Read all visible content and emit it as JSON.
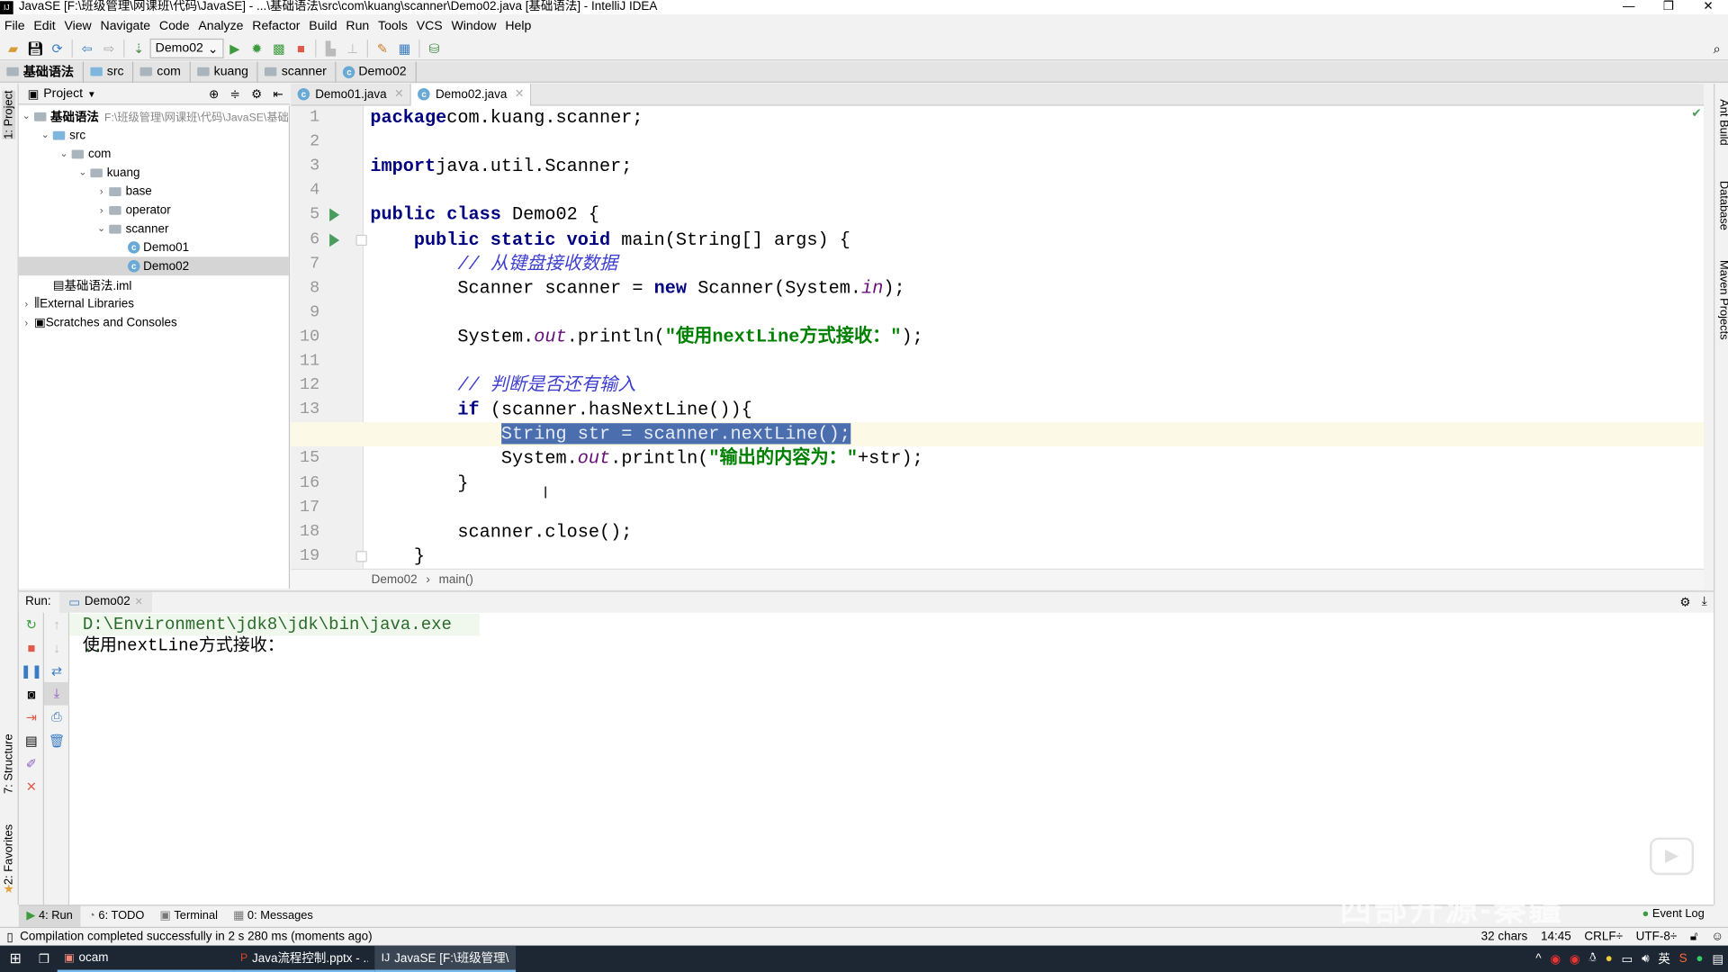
{
  "window": {
    "title": "JavaSE [F:\\班级管理\\网课班\\代码\\JavaSE] - ...\\基础语法\\src\\com\\kuang\\scanner\\Demo02.java [基础语法] - IntelliJ IDEA",
    "logo": "IJ"
  },
  "menu": [
    "File",
    "Edit",
    "View",
    "Navigate",
    "Code",
    "Analyze",
    "Refactor",
    "Build",
    "Run",
    "Tools",
    "VCS",
    "Window",
    "Help"
  ],
  "toolbar": {
    "run_config": "Demo02"
  },
  "breadcrumbs": [
    "基础语法",
    "src",
    "com",
    "kuang",
    "scanner",
    "Demo02"
  ],
  "left_strip": {
    "project": "1: Project",
    "structure": "7: Structure",
    "favorites": "2: Favorites"
  },
  "right_strip": [
    "Ant Build",
    "Database",
    "Maven Projects"
  ],
  "project": {
    "header": "Project",
    "root": {
      "name": "基础语法",
      "path": "F:\\班级管理\\网课班\\代码\\JavaSE\\基础"
    },
    "nodes": [
      {
        "label": "src",
        "type": "src-folder",
        "arrow": "v",
        "depth": 1
      },
      {
        "label": "com",
        "type": "folder",
        "arrow": "v",
        "depth": 2
      },
      {
        "label": "kuang",
        "type": "folder",
        "arrow": "v",
        "depth": 3
      },
      {
        "label": "base",
        "type": "folder",
        "arrow": ">",
        "depth": 4
      },
      {
        "label": "operator",
        "type": "folder",
        "arrow": ">",
        "depth": 4
      },
      {
        "label": "scanner",
        "type": "folder",
        "arrow": "v",
        "depth": 4
      },
      {
        "label": "Demo01",
        "type": "class",
        "arrow": "",
        "depth": 5
      },
      {
        "label": "Demo02",
        "type": "class",
        "arrow": "",
        "depth": 5,
        "selected": true
      },
      {
        "label": "基础语法.iml",
        "type": "iml",
        "arrow": "",
        "depth": 1
      },
      {
        "label": "External Libraries",
        "type": "lib",
        "arrow": ">",
        "depth": 0
      },
      {
        "label": "Scratches and Consoles",
        "type": "scratch",
        "arrow": ">",
        "depth": 0
      }
    ]
  },
  "editor_tabs": [
    {
      "label": "Demo01.java",
      "active": false
    },
    {
      "label": "Demo02.java",
      "active": true
    }
  ],
  "code": [
    [
      [
        "kw",
        "package"
      ],
      [
        "",
        "com.kuang.scanner;"
      ]
    ],
    [],
    [
      [
        "kw",
        "import"
      ],
      [
        "",
        "java.util.Scanner;"
      ]
    ],
    [],
    [
      [
        "kw",
        "public class"
      ],
      [
        "",
        " Demo02 {"
      ]
    ],
    [
      [
        "",
        "    "
      ],
      [
        "kw",
        "public static void"
      ],
      [
        "",
        " main(String[] args) {"
      ]
    ],
    [
      [
        "",
        "        "
      ],
      [
        "cm",
        "// 从键盘接收数据"
      ]
    ],
    [
      [
        "",
        "        Scanner scanner = "
      ],
      [
        "kw",
        "new"
      ],
      [
        "",
        " Scanner(System."
      ],
      [
        "it",
        "in"
      ],
      [
        "",
        ");"
      ]
    ],
    [],
    [
      [
        "",
        "        System."
      ],
      [
        "it",
        "out"
      ],
      [
        "",
        ".println("
      ],
      [
        "str",
        "\"使用nextLine方式接收：\""
      ],
      [
        "",
        ");"
      ]
    ],
    [],
    [
      [
        "",
        "        "
      ],
      [
        "cm",
        "// 判断是否还有输入"
      ]
    ],
    [
      [
        "",
        "        "
      ],
      [
        "kw",
        "if"
      ],
      [
        "",
        " (scanner.hasNextLine()){"
      ]
    ],
    [
      [
        "",
        "            "
      ],
      [
        "selx",
        "String str = scanner.nextLine();"
      ]
    ],
    [
      [
        "",
        "            System."
      ],
      [
        "it",
        "out"
      ],
      [
        "",
        ".println("
      ],
      [
        "str",
        "\"输出的内容为：\""
      ],
      [
        "",
        "+str);"
      ]
    ],
    [
      [
        "",
        "        }"
      ]
    ],
    [],
    [
      [
        "",
        "        scanner.close();"
      ]
    ],
    [
      [
        "",
        "    }"
      ]
    ]
  ],
  "editor": {
    "current_line": 14,
    "run_gutter_lines": [
      5,
      6
    ]
  },
  "editor_breadcrumb": [
    "Demo02",
    "main()"
  ],
  "run": {
    "label": "Run:",
    "tab": "Demo02",
    "console": [
      "D:\\Environment\\jdk8\\jdk\\bin\\java.exe ...",
      "使用nextLine方式接收："
    ]
  },
  "tool_windows": [
    {
      "label": "4: Run",
      "active": true
    },
    {
      "label": "6: TODO"
    },
    {
      "label": "Terminal"
    },
    {
      "label": "0: Messages"
    }
  ],
  "event_log": "Event Log",
  "status": {
    "message": "Compilation completed successfully in 2 s 280 ms (moments ago)",
    "chars": "32 chars",
    "position": "14:45",
    "line_sep": "CRLF÷",
    "encoding": "UTF-8÷"
  },
  "taskbar": {
    "items": [
      {
        "label": "ocam"
      },
      {
        "label": "Java流程控制.pptx - ..."
      },
      {
        "label": "JavaSE [F:\\班级管理\\...",
        "active": true
      }
    ],
    "ime": "英"
  },
  "watermark": "西部开源-秦疆"
}
